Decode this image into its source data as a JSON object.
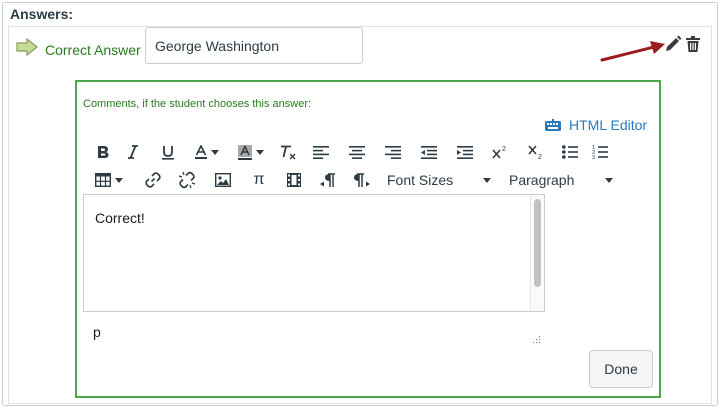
{
  "section": {
    "heading": "Answers:"
  },
  "answer": {
    "label": "Correct Answer",
    "value": "George Washington"
  },
  "comments": {
    "label": "Comments, if the student chooses this answer:",
    "html_editor_label": "HTML Editor",
    "toolbar": {
      "font_sizes": "Font Sizes",
      "paragraph": "Paragraph",
      "row1_icons": [
        "bold-icon",
        "italic-icon",
        "underline-icon",
        "text-color-icon",
        "background-color-icon",
        "clear-formatting-icon",
        "align-left-icon",
        "align-center-icon",
        "align-right-icon",
        "outdent-icon",
        "indent-icon",
        "superscript-icon",
        "subscript-icon",
        "bullet-list-icon",
        "numbered-list-icon"
      ],
      "row2_icons": [
        "table-icon",
        "link-icon",
        "unlink-icon",
        "image-icon",
        "pi-icon",
        "media-icon",
        "ltr-icon",
        "rtl-icon"
      ]
    },
    "content": "Correct!",
    "path": "p",
    "done_label": "Done"
  },
  "colors": {
    "correct_green": "#2a7a1e",
    "comment_border": "#4aa64b",
    "link_blue": "#2b7abc",
    "annotation_red": "#9b1c1c"
  }
}
